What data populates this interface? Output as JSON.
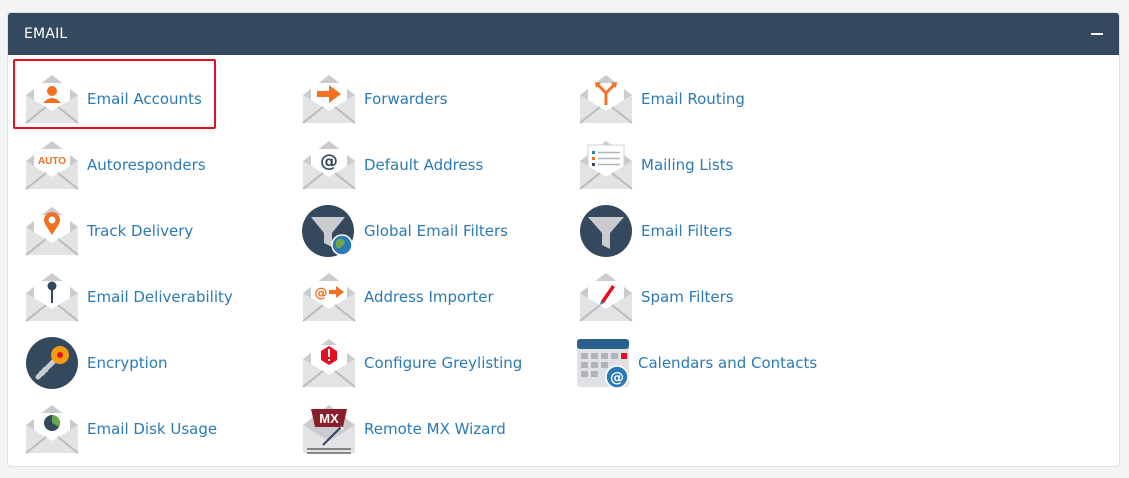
{
  "panel": {
    "title": "EMAIL",
    "collapse_icon": "minus-icon"
  },
  "items": [
    {
      "label": "Email Accounts",
      "icon": "email-accounts-icon"
    },
    {
      "label": "Forwarders",
      "icon": "forwarders-icon"
    },
    {
      "label": "Email Routing",
      "icon": "email-routing-icon"
    },
    {
      "label": "Autoresponders",
      "icon": "autoresponders-icon"
    },
    {
      "label": "Default Address",
      "icon": "default-address-icon"
    },
    {
      "label": "Mailing Lists",
      "icon": "mailing-lists-icon"
    },
    {
      "label": "Track Delivery",
      "icon": "track-delivery-icon"
    },
    {
      "label": "Global Email Filters",
      "icon": "global-email-filters-icon"
    },
    {
      "label": "Email Filters",
      "icon": "email-filters-icon"
    },
    {
      "label": "Email Deliverability",
      "icon": "email-deliverability-icon"
    },
    {
      "label": "Address Importer",
      "icon": "address-importer-icon"
    },
    {
      "label": "Spam Filters",
      "icon": "spam-filters-icon"
    },
    {
      "label": "Encryption",
      "icon": "encryption-icon"
    },
    {
      "label": "Configure Greylisting",
      "icon": "configure-greylisting-icon"
    },
    {
      "label": "Calendars and Contacts",
      "icon": "calendars-contacts-icon"
    },
    {
      "label": "Email Disk Usage",
      "icon": "email-disk-usage-icon"
    },
    {
      "label": "Remote MX Wizard",
      "icon": "remote-mx-wizard-icon"
    }
  ],
  "icon_text": {
    "auto": "AUTO",
    "at": "@",
    "mx": "MX"
  },
  "colors": {
    "header": "#34495e",
    "link": "#2b7ab5",
    "accent": "#f36f21",
    "highlight": "#e4101f"
  }
}
